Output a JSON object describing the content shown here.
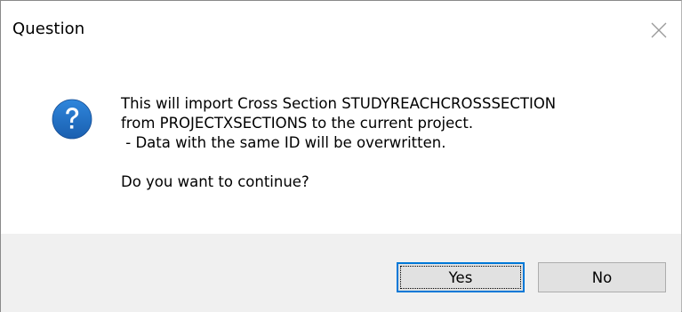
{
  "dialog": {
    "title": "Question",
    "close_icon": "close-icon",
    "icon": "question-icon",
    "icon_color": "#1f6fc5",
    "message_lines": [
      "This will import Cross Section STUDYREACHCROSSSECTION",
      "from PROJECTXSECTIONS to the current project.",
      " - Data with the same ID will be overwritten."
    ],
    "prompt": "Do you want to continue?",
    "buttons": {
      "yes_label": "Yes",
      "no_label": "No"
    },
    "accent_color": "#0078d7",
    "footer_color": "#f0f0f0"
  }
}
